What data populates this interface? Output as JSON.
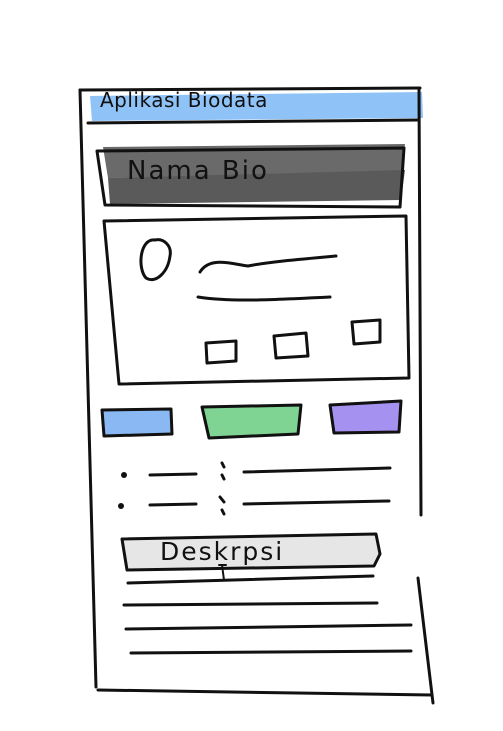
{
  "app": {
    "title": "Aplikasi Biodata"
  },
  "header": {
    "name_label": "Nama Bio"
  },
  "buttons": [
    {
      "color": "#8ab8f2",
      "name": "button-blue"
    },
    {
      "color": "#7fd494",
      "name": "button-green"
    },
    {
      "color": "#a591ef",
      "name": "button-purple"
    }
  ],
  "description": {
    "label": "Deskrpsi"
  },
  "colors": {
    "title_bar": "#8fc3f7",
    "name_banner": "#6a6a6a",
    "desc_field": "#e6e6e6",
    "ink": "#111111"
  }
}
